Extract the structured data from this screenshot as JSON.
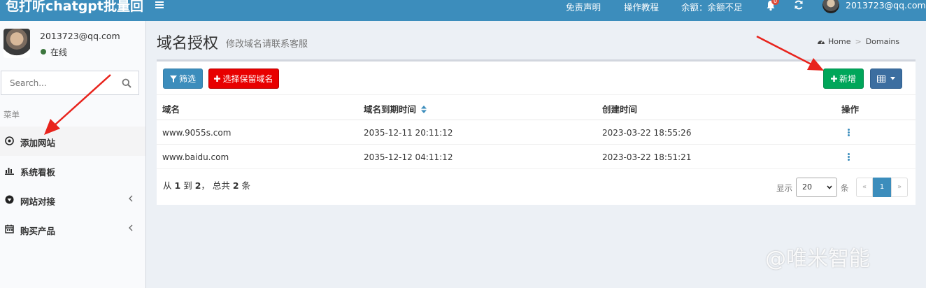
{
  "app": {
    "title": "包打听chatgpt批量回"
  },
  "topbar": {
    "disclaimer": "免责声明",
    "tutorial": "操作教程",
    "balance": "余额：余额不足",
    "notification_count": "0",
    "user_email": "2013723@qq.com"
  },
  "sidebar": {
    "user": {
      "email": "2013723@qq.com",
      "status": "在线"
    },
    "search": {
      "placeholder": "Search..."
    },
    "menu_header": "菜单",
    "items": [
      {
        "label": "添加网站",
        "icon": "plus-circle-icon",
        "active": true
      },
      {
        "label": "系统看板",
        "icon": "bar-chart-icon",
        "active": false
      },
      {
        "label": "网站对接",
        "icon": "arrow-circle-icon",
        "active": false,
        "has_children": true
      },
      {
        "label": "购买产品",
        "icon": "calendar-icon",
        "active": false,
        "has_children": true
      }
    ]
  },
  "page": {
    "title": "域名授权",
    "subtitle": "修改域名请联系客服",
    "breadcrumb": {
      "home": "Home",
      "current": "Domains"
    }
  },
  "toolbar": {
    "filter_label": "筛选",
    "reserve_label": "选择保留域名",
    "add_label": "新增"
  },
  "table": {
    "columns": [
      "域名",
      "域名到期时间",
      "创建时间",
      "操作"
    ],
    "rows": [
      {
        "domain": "www.9055s.com",
        "expires": "2035-12-11 20:11:12",
        "created": "2023-03-22 18:55:26"
      },
      {
        "domain": "www.baidu.com",
        "expires": "2035-12-12 04:11:12",
        "created": "2023-03-22 18:51:21"
      }
    ]
  },
  "pagination": {
    "summary_prefix": "从",
    "from": "1",
    "to_word": "到",
    "to": "2",
    "total_prefix": "， 总共",
    "total": "2",
    "total_suffix": "条",
    "show_label": "显示",
    "page_size": "20",
    "rows_label": "条",
    "prev": "«",
    "current_page": "1",
    "next": "»"
  },
  "watermark": "@唯米智能",
  "colors": {
    "topbar": "#3c8dbc",
    "filter_button": "#3c8dbc",
    "reserve_button": "#e80000",
    "add_button": "#00a65a",
    "columns_button": "#3c6ea0",
    "annotation_arrow": "#e8231c"
  }
}
